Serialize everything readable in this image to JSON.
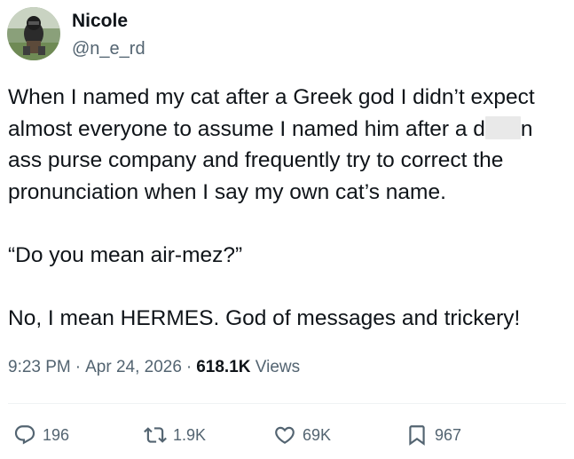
{
  "user": {
    "display_name": "Nicole",
    "handle": "@n_e_rd"
  },
  "tweet": {
    "line1": "When I named my cat after a Greek god I didn’t expect",
    "line2_before": "almost everyone to assume I named him after a d",
    "line2_after": "n",
    "line3": "ass purse company and frequently try to correct the",
    "line4": "pronunciation when I say my own cat’s name.",
    "quote": "“Do you mean air-mez?”",
    "reply": "No, I mean HERMES. God of messages and trickery!"
  },
  "meta": {
    "time": "9:23 PM",
    "separator": "·",
    "date": "Apr 24, 2026",
    "views_count": "618.1K",
    "views_label": "Views"
  },
  "actions": {
    "replies": "196",
    "reposts": "1.9K",
    "likes": "69K",
    "bookmarks": "967"
  },
  "colors": {
    "text": "#0f1419",
    "secondary": "#536471",
    "divider": "#eff3f4"
  },
  "icons": [
    "reply-icon",
    "repost-icon",
    "like-icon",
    "bookmark-icon"
  ]
}
